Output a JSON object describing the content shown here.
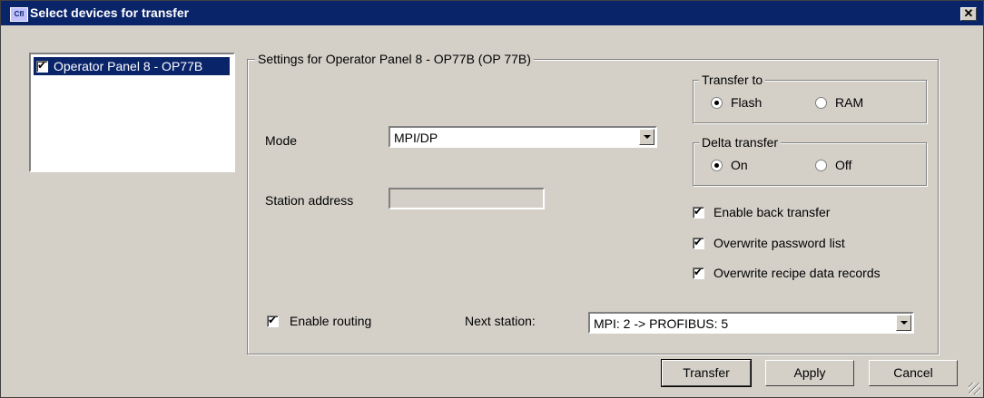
{
  "window": {
    "title": "Select devices for transfer",
    "icon_text": "Cfl",
    "close_label": "✕"
  },
  "devices": [
    {
      "label": "Operator Panel 8 - OP77B",
      "checked": true,
      "selected": true
    }
  ],
  "settings": {
    "group_title": "Settings for Operator Panel 8 - OP77B (OP 77B)",
    "mode_label": "Mode",
    "mode_value": "MPI/DP",
    "station_address_label": "Station address",
    "station_address_value": "",
    "transfer_to": {
      "title": "Transfer to",
      "options": [
        "Flash",
        "RAM"
      ],
      "selected": "Flash"
    },
    "delta_transfer": {
      "title": "Delta transfer",
      "options": [
        "On",
        "Off"
      ],
      "selected": "On"
    },
    "enable_back_transfer": "Enable back transfer",
    "overwrite_password_list": "Overwrite password list",
    "overwrite_recipe": "Overwrite recipe data records",
    "enable_routing": "Enable routing",
    "next_station_label": "Next station:",
    "next_station_value": "MPI: 2 -> PROFIBUS: 5"
  },
  "buttons": {
    "transfer": "Transfer",
    "apply": "Apply",
    "cancel": "Cancel"
  }
}
